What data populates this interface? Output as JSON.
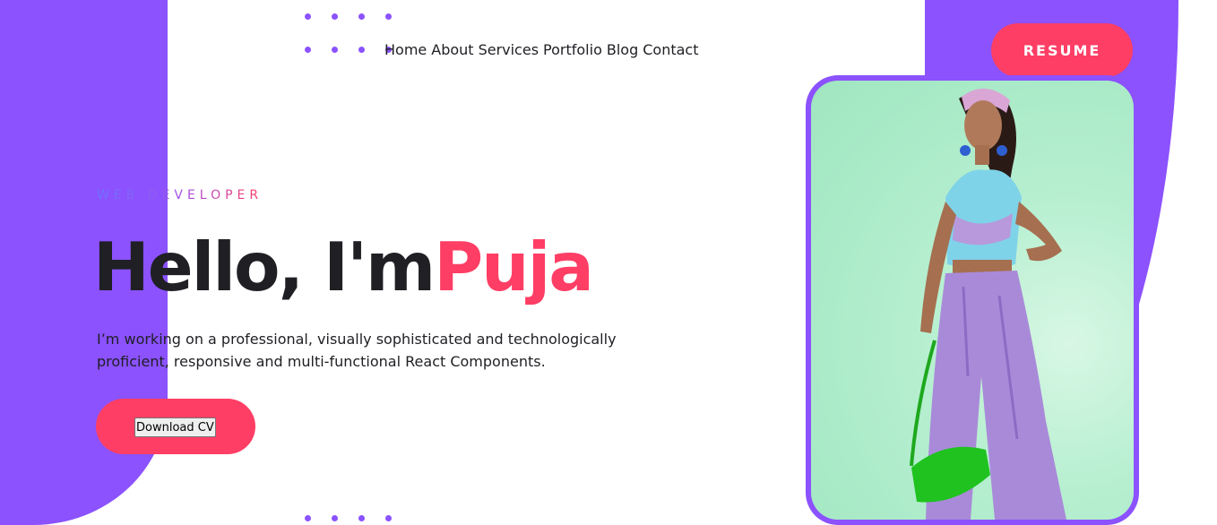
{
  "nav": {
    "links": [
      "Home",
      "About",
      "Services",
      "Portfolio",
      "Blog",
      "Contact"
    ]
  },
  "header": {
    "resume_label": "RESUME"
  },
  "hero": {
    "role": "WEB DEVELOPER",
    "greeting": "Hello, I'm",
    "name": "Puja",
    "description": "I’m working on a professional, visually sophisticated and technologically proficient, responsive and multi-functional React Components.",
    "download_label": "Download CV"
  },
  "colors": {
    "accent_purple": "#8b52fe",
    "accent_pink": "#fe3e65",
    "text_dark": "#1f1f24",
    "photo_bg": "#a8ebc8"
  },
  "icons": {
    "dots": "dot-grid-icon"
  }
}
